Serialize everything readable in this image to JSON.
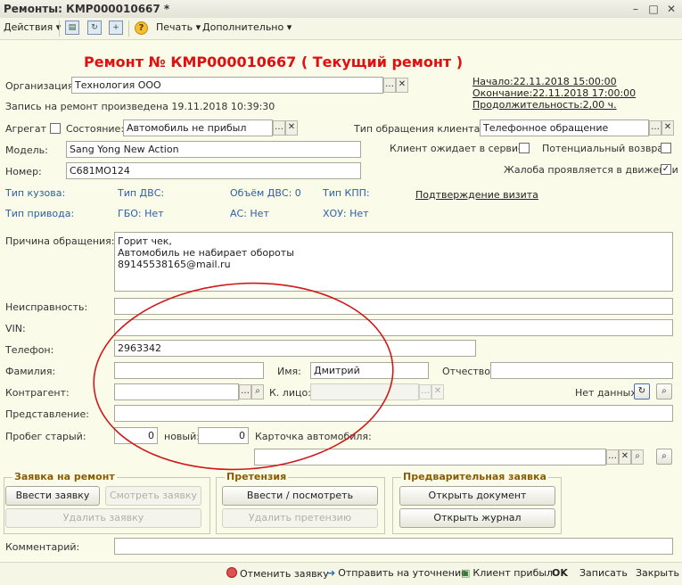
{
  "window": {
    "title": "Ремонты: КМР000010667 *"
  },
  "toolbar": {
    "actions": "Действия",
    "print": "Печать",
    "more": "Дополнительно"
  },
  "heading": "Ремонт № КМР000010667 ( Текущий ремонт )",
  "org": {
    "label": "Организация:",
    "value": "Технология ООО"
  },
  "record": "Запись на ремонт произведена 19.11.2018 10:39:30",
  "times": {
    "start": "Начало:22.11.2018 15:00:00",
    "end": "Окончание:22.11.2018 17:00:00",
    "duration": "Продолжительность:2,00 ч."
  },
  "aggregate_label": "Агрегат",
  "state": {
    "label": "Состояние:",
    "value": "Автомобиль не прибыл"
  },
  "appeal_type": {
    "label": "Тип обращения клиента:",
    "value": "Телефонное обращение"
  },
  "model": {
    "label": "Модель:",
    "value": "Sang Yong New Action"
  },
  "number": {
    "label": "Номер:",
    "value": "С681МО124"
  },
  "client_waiting": "Клиент ожидает в сервисе",
  "potential_return": "Потенциальный возврат",
  "complaint_motion": "Жалоба проявляется в движении",
  "car_info": {
    "body": "Тип кузова:",
    "engine": "Тип ДВС:",
    "volume": "Объём ДВС: 0",
    "gearbox": "Тип КПП:",
    "drive": "Тип привода:",
    "gbo": "ГБО: Нет",
    "ac": "АС: Нет",
    "hou": "ХОУ: Нет"
  },
  "visit_link": "Подтверждение визита",
  "reason": {
    "label": "Причина обращения:",
    "lines": [
      "Горит чек,",
      "Автомобиль не набирает обороты",
      "89145538165@mail.ru"
    ]
  },
  "fault_label": "Неисправность:",
  "vin_label": "VIN:",
  "phone": {
    "label": "Телефон:",
    "value": "2963342"
  },
  "surname_label": "Фамилия:",
  "name": {
    "label": "Имя:",
    "value": "Дмитрий"
  },
  "patronymic_label": "Отчество:",
  "contractor_label": "Контрагент:",
  "contact_label": "К. лицо:",
  "no_data": "Нет данных.",
  "representation_label": "Представление:",
  "mileage": {
    "old_label": "Пробег старый:",
    "old": "0",
    "new_label": "новый:",
    "new": "0"
  },
  "car_card_label": "Карточка автомобиля:",
  "groups": {
    "repair": {
      "title": "Заявка на ремонт",
      "enter": "Ввести заявку",
      "view": "Смотреть заявку",
      "delete": "Удалить заявку"
    },
    "claim": {
      "title": "Претензия",
      "enter": "Ввести / посмотреть претензию",
      "delete": "Удалить претензию"
    },
    "prelim": {
      "title": "Предварительная заявка",
      "open_doc": "Открыть документ",
      "open_journal": "Открыть журнал"
    }
  },
  "comment_label": "Комментарий:",
  "bottom": {
    "cancel": "Отменить заявку",
    "send": "Отправить на уточнение",
    "arrived": "Клиент прибыл",
    "ok": "OK",
    "save": "Записать",
    "close": "Закрыть"
  },
  "colors": {
    "heading": "#e01010",
    "annotation": "#d01818",
    "group_title": "#8a5c00",
    "link_blue": "#2a5fa8"
  }
}
